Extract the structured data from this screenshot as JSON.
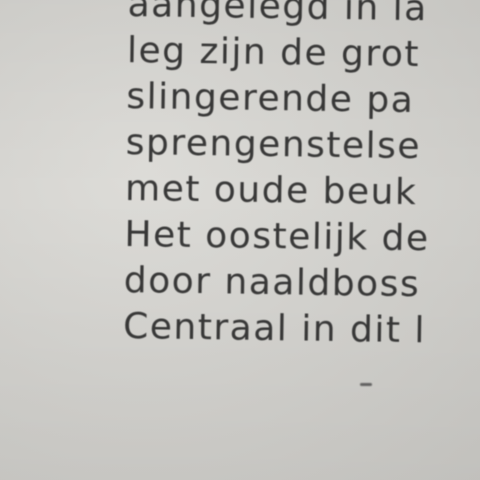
{
  "document": {
    "lines": [
      "aangelegd in la",
      "leg zijn de grot",
      "slingerende pa",
      "sprengenstelse",
      "met oude beuk",
      "Het oostelijk de",
      "door naaldboss",
      "Centraal in dit l"
    ]
  },
  "colors": {
    "paper": "#d3d3cf",
    "ink": "#2b2b2b"
  }
}
